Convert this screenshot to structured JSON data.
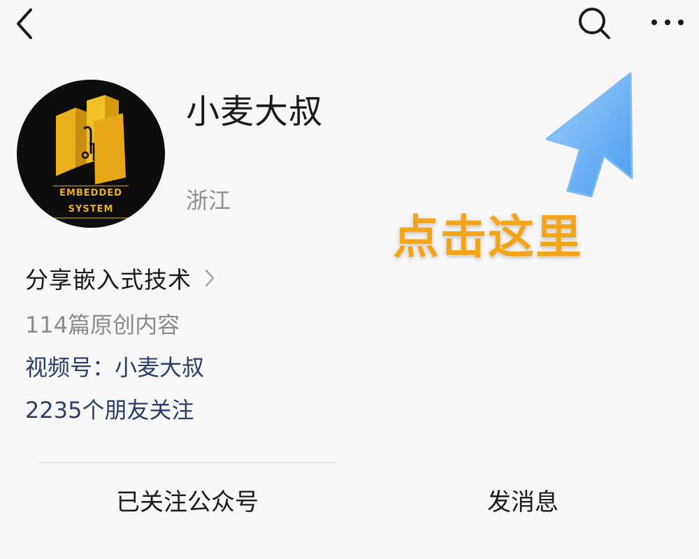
{
  "profile": {
    "name": "小麦大叔",
    "region": "浙江",
    "avatar_text_line1": "EMBEDDED",
    "avatar_text_line2": "SYSTEM",
    "intro": "分享嵌入式技术",
    "articles": "114篇原创内容",
    "channels": "视频号：小麦大叔",
    "friends_following": "2235个朋友关注"
  },
  "overlay": {
    "hint_text": "点击这里",
    "hint_color": "#f2a51a",
    "arrow_color": "#5aa9f2"
  },
  "actions": {
    "follow_label": "已关注公众号",
    "message_label": "发消息"
  },
  "icons": {
    "back": "chevron-left-icon",
    "search": "search-icon",
    "more": "more-horizontal-icon",
    "intro_chevron": "chevron-right-icon"
  }
}
